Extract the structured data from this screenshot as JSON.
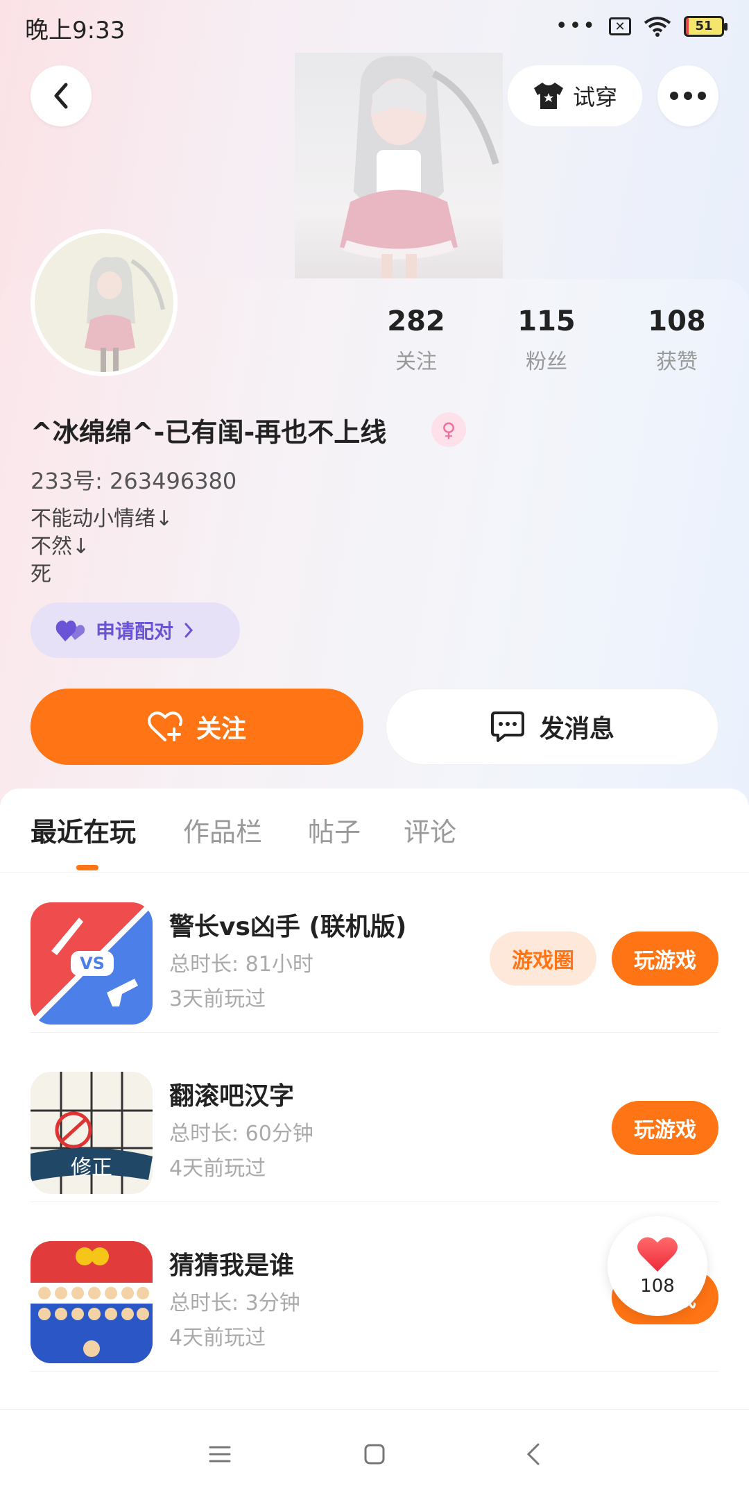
{
  "status_bar": {
    "time": "晚上9:33",
    "dots": "•••",
    "battery": "51"
  },
  "header": {
    "try_on_label": "试穿"
  },
  "profile": {
    "stats": [
      {
        "value": "282",
        "label": "关注"
      },
      {
        "value": "115",
        "label": "粉丝"
      },
      {
        "value": "108",
        "label": "获赞"
      }
    ],
    "nickname": "^冰绵绵^-已有闺-再也不上线",
    "gender_symbol": "♀",
    "user_id": "233号: 263496380",
    "bio_lines": [
      "不能动小情绪↓",
      "不然↓",
      "死"
    ],
    "pair_label": "申请配对",
    "follow_label": "关注",
    "message_label": "发消息"
  },
  "tabs": [
    {
      "label": "最近在玩",
      "active": true
    },
    {
      "label": "作品栏",
      "active": false
    },
    {
      "label": "帖子",
      "active": false
    },
    {
      "label": "评论",
      "active": false
    }
  ],
  "games": [
    {
      "name": "警长vs凶手 (联机版)",
      "total_time": "总时长: 81小时",
      "last_played": "3天前玩过",
      "circle_label": "游戏圈",
      "play_label": "玩游戏",
      "icon_text": "VS"
    },
    {
      "name": "翻滚吧汉字",
      "total_time": "总时长: 60分钟",
      "last_played": "4天前玩过",
      "play_label": "玩游戏",
      "icon_text": "修正"
    },
    {
      "name": "猜猜我是谁",
      "total_time": "总时长: 3分钟",
      "last_played": "4天前玩过",
      "play_label": "玩游戏"
    }
  ],
  "floating_like": {
    "count": "108"
  },
  "colors": {
    "accent": "#ff7414",
    "pair_purple": "#6a53d6",
    "female_pink": "#ef6e9b"
  }
}
